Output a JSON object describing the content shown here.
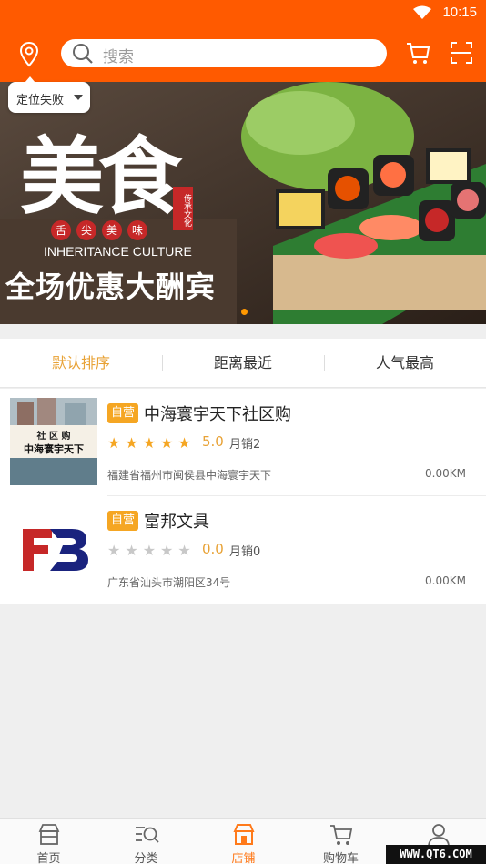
{
  "status_bar": {
    "time": "10:15",
    "wifi_icon": "wifi-icon"
  },
  "header": {
    "location_icon": "map-pin-icon",
    "search_placeholder": "搜索",
    "cart_icon": "cart-icon",
    "scan_icon": "scan-icon",
    "background_color": "#ff5a00"
  },
  "location_tip": {
    "text": "定位失败"
  },
  "banner": {
    "brush_title": "美食",
    "seal_text": "传承文化",
    "red_circles": [
      "舌",
      "尖",
      "美",
      "味"
    ],
    "english": "INHERITANCE CULTURE",
    "slogan": "全场优惠大酬宾",
    "active_slide": 1
  },
  "sort_tabs": [
    {
      "label": "默认排序",
      "active": true
    },
    {
      "label": "距离最近",
      "active": false
    },
    {
      "label": "人气最高",
      "active": false
    }
  ],
  "shops": [
    {
      "tag": "自营",
      "name": "中海寰宇天下社区购",
      "rating": 5,
      "score_text": "5.0",
      "sales": "月销2",
      "address": "福建省福州市闽侯县中海寰宇天下",
      "distance": "0.00KM",
      "thumb_text_1": "社 区 购",
      "thumb_text_2": "中海寰宇天下"
    },
    {
      "tag": "自营",
      "name": "富邦文具",
      "rating": 0,
      "score_text": "0.0",
      "sales": "月销0",
      "address": "广东省汕头市潮阳区34号",
      "distance": "0.00KM",
      "logo_letters": "FB"
    }
  ],
  "bottom_nav": [
    {
      "label": "首页",
      "icon": "home-store-icon",
      "active": false
    },
    {
      "label": "分类",
      "icon": "category-search-icon",
      "active": false
    },
    {
      "label": "店铺",
      "icon": "shop-icon",
      "active": true
    },
    {
      "label": "购物车",
      "icon": "cart-icon",
      "active": false
    },
    {
      "label": "",
      "icon": "user-icon",
      "active": false
    }
  ],
  "watermark": "WWW.QT6.COM",
  "colors": {
    "accent": "#ff5a00",
    "star": "#f5a623",
    "active_tab": "#e8a236",
    "star_off": "#c8c8c8"
  }
}
